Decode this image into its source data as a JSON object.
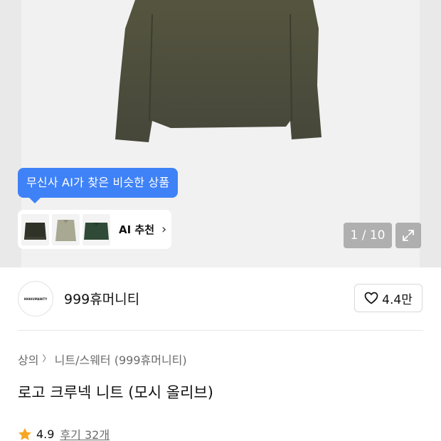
{
  "hero": {
    "ai_tooltip": "무신사 AI가 찾은 비슷한 상품",
    "ai_recommend_label": "AI 추천",
    "ai_recommend_chevron": "›",
    "image_counter": "1 / 10",
    "thumbnails": [
      {
        "color": "#2f3227"
      },
      {
        "color": "#a8a893"
      },
      {
        "color": "#2f4a36"
      }
    ]
  },
  "brand": {
    "logo_text": "999HUMANITY",
    "name": "999휴머니티",
    "like_count": "4.4만"
  },
  "product": {
    "breadcrumb": [
      "상의",
      "니트/스웨터 (999휴머니티)"
    ],
    "breadcrumb_separator": "〉",
    "title": "로고 크루넥 니트 (모시 올리브)",
    "rating": "4.9",
    "reviews": "후기 32개"
  },
  "colors": {
    "accent_blue": "#3f82f7",
    "star": "#f5a623",
    "sweater": "#4a4a38"
  },
  "icons": {
    "expand": "expand-icon",
    "like": "heart-outline-icon",
    "star": "star-icon"
  }
}
